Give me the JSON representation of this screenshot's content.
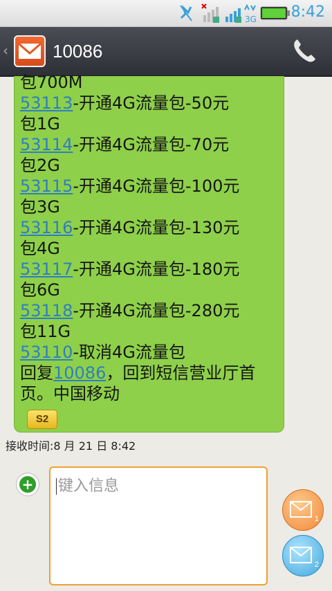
{
  "status_bar": {
    "time": "8:42",
    "network_label": "3G"
  },
  "header": {
    "contact": "10086"
  },
  "message": {
    "lines": [
      {
        "pre": "",
        "link": "",
        "post": "包700M"
      },
      {
        "pre": "",
        "link": "53113",
        "post": "-开通4G流量包-50元"
      },
      {
        "pre": "",
        "link": "",
        "post": "包1G"
      },
      {
        "pre": "",
        "link": "53114",
        "post": "-开通4G流量包-70元"
      },
      {
        "pre": "",
        "link": "",
        "post": "包2G"
      },
      {
        "pre": "",
        "link": "53115",
        "post": "-开通4G流量包-100元"
      },
      {
        "pre": "",
        "link": "",
        "post": "包3G"
      },
      {
        "pre": "",
        "link": "53116",
        "post": "-开通4G流量包-130元"
      },
      {
        "pre": "",
        "link": "",
        "post": "包4G"
      },
      {
        "pre": "",
        "link": "53117",
        "post": "-开通4G流量包-180元"
      },
      {
        "pre": "",
        "link": "",
        "post": "包6G"
      },
      {
        "pre": "",
        "link": "53118",
        "post": "-开通4G流量包-280元"
      },
      {
        "pre": "",
        "link": "",
        "post": "包11G"
      },
      {
        "pre": "",
        "link": "53110",
        "post": "-取消4G流量包"
      },
      {
        "pre": "回复",
        "link": "10086",
        "post": "，回到短信营业厅首"
      },
      {
        "pre": "",
        "link": "",
        "post": "页。中国移动"
      }
    ],
    "sim_badge": "S2",
    "received_time": "接收时间:8 月 21 日 8:42"
  },
  "composer": {
    "placeholder": "键入信息",
    "send_sim1_label": "1",
    "send_sim2_label": "2"
  },
  "colors": {
    "bubble": "#8ed04a",
    "link": "#2f7fbf",
    "header": "#3a3c44",
    "accent_orange": "#f08a3a",
    "accent_blue": "#42a8dc"
  }
}
